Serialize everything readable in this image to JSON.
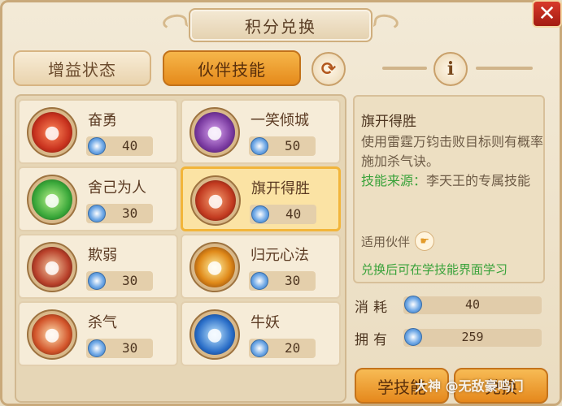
{
  "header": {
    "title": "积分兑换",
    "close_glyph": "✕"
  },
  "tabs": [
    {
      "label": "增益状态",
      "active": false
    },
    {
      "label": "伙伴技能",
      "active": true
    }
  ],
  "toolbar": {
    "refresh_icon": "refresh-icon",
    "refresh_glyph": "⟳",
    "info_icon": "info-icon",
    "info_glyph": "i"
  },
  "skills": [
    {
      "name": "奋勇",
      "cost": "40",
      "icon": "red-warrior-icon",
      "color": "#c8321e",
      "selected": false
    },
    {
      "name": "一笑倾城",
      "cost": "50",
      "icon": "purple-charm-icon",
      "color": "#7a3aa0",
      "selected": false
    },
    {
      "name": "舍己为人",
      "cost": "30",
      "icon": "green-shield-icon",
      "color": "#3aa83a",
      "selected": false
    },
    {
      "name": "旗开得胜",
      "cost": "40",
      "icon": "banner-strike-icon",
      "color": "#c23a20",
      "selected": true
    },
    {
      "name": "欺弱",
      "cost": "30",
      "icon": "bully-strike-icon",
      "color": "#b8402a",
      "selected": false
    },
    {
      "name": "归元心法",
      "cost": "30",
      "icon": "sun-burst-icon",
      "color": "#e08a1a",
      "selected": false
    },
    {
      "name": "杀气",
      "cost": "30",
      "icon": "killing-aura-icon",
      "color": "#d2542a",
      "selected": false
    },
    {
      "name": "牛妖",
      "cost": "20",
      "icon": "ox-demon-icon",
      "color": "#2a6ec8",
      "selected": false
    }
  ],
  "detail": {
    "title": "旗开得胜",
    "description": "使用雷霆万钧击败目标则有概率施加杀气诀。",
    "source_label": "技能来源：",
    "source_value": "李天王的专属技能",
    "partner_label": "适用伙伴",
    "note": "兑换后可在学技能界面学习"
  },
  "resources": {
    "cost_label": "消耗",
    "cost_value": "40",
    "own_label": "拥有",
    "own_value": "259"
  },
  "actions": {
    "learn_label": "学技能",
    "exchange_label": "兑换"
  },
  "watermark": "大神 @无敌豪鸣门"
}
